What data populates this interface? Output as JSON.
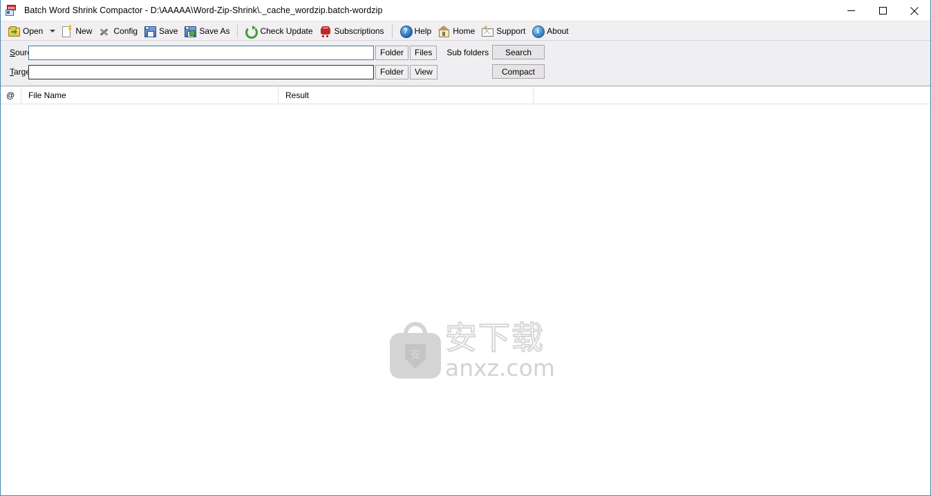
{
  "window": {
    "title": "Batch Word Shrink Compactor - D:\\AAAAA\\Word-Zip-Shrink\\._cache_wordzip.batch-wordzip",
    "app_icon": "word-zip-document-icon",
    "controls": {
      "minimize": "minimize-icon",
      "maximize": "maximize-icon",
      "close": "close-icon"
    }
  },
  "toolbar": {
    "items": [
      {
        "label": "Open",
        "icon": "folder-open-icon",
        "dropdown": true
      },
      {
        "label": "New",
        "icon": "new-document-icon",
        "dropdown": false
      },
      {
        "label": "Config",
        "icon": "tools-icon",
        "dropdown": false
      },
      {
        "label": "Save",
        "icon": "floppy-disk-icon",
        "dropdown": false
      },
      {
        "label": "Save As",
        "icon": "floppy-disk-as-icon",
        "dropdown": false
      },
      {
        "label": "Check Update",
        "icon": "refresh-icon",
        "dropdown": false
      },
      {
        "label": "Subscriptions",
        "icon": "shopping-cart-icon",
        "dropdown": false
      },
      {
        "label": "Help",
        "icon": "question-circle-icon",
        "dropdown": false
      },
      {
        "label": "Home",
        "icon": "house-icon",
        "dropdown": false
      },
      {
        "label": "Support",
        "icon": "envelope-icon",
        "dropdown": false
      },
      {
        "label": "About",
        "icon": "info-circle-icon",
        "dropdown": false
      }
    ]
  },
  "form": {
    "source": {
      "label_prefix": "S",
      "label_rest": "ource",
      "value": "",
      "placeholder": "",
      "folder_button": "Folder",
      "files_button": "Files"
    },
    "target": {
      "label_prefix": "T",
      "label_rest": "arget",
      "value": "",
      "placeholder": "",
      "folder_button": "Folder",
      "view_button": "View"
    },
    "sub_folders_label": "Sub folders",
    "sub_folders_checked": false,
    "search_button": "Search",
    "compact_button": "Compact"
  },
  "list": {
    "columns": [
      {
        "key": "at",
        "label": "@"
      },
      {
        "key": "filename",
        "label": "File Name"
      },
      {
        "key": "result",
        "label": "Result"
      }
    ],
    "rows": []
  },
  "watermark": {
    "chinese": "安下载",
    "domain": "anxz.com",
    "shield_char": "安"
  },
  "colors": {
    "window_border": "#4a86b0",
    "toolbar_bg": "#f1eff1",
    "form_bg": "#efeef0",
    "source_focus_border": "#3c7c9c",
    "watermark_gray": "#d4d4d4"
  }
}
